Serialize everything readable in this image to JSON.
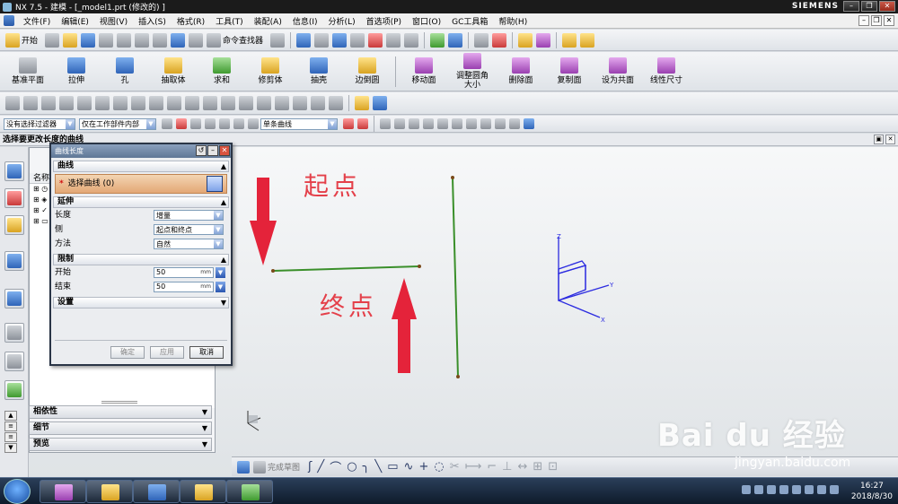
{
  "window": {
    "title": "NX 7.5 - 建模 - [_model1.prt (修改的) ]",
    "brand": "SIEMENS"
  },
  "menu": [
    "文件(F)",
    "编辑(E)",
    "视图(V)",
    "插入(S)",
    "格式(R)",
    "工具(T)",
    "装配(A)",
    "信息(I)",
    "分析(L)",
    "首选项(P)",
    "窗口(O)",
    "GC工具箱",
    "帮助(H)"
  ],
  "toolbar1": {
    "start": "开始",
    "command_finder": "命令查找器"
  },
  "feature_toolbar": {
    "left": [
      "基准平面",
      "拉伸",
      "孔",
      "抽取体",
      "求和",
      "修剪体",
      "抽壳",
      "边倒圆"
    ],
    "right": [
      "移动面",
      "调整圆角大小",
      "删除面",
      "复制面",
      "设为共面",
      "线性尺寸"
    ]
  },
  "filter_bar": {
    "type_filter": "没有选择过滤器",
    "scope": "仅在工作部件内部",
    "intent": "单条曲线"
  },
  "cue_line": "选择要更改长度的曲线",
  "navigator": {
    "column_name": "名称",
    "accordions": [
      "相依性",
      "细节",
      "预览"
    ]
  },
  "dialog": {
    "title": "曲线长度",
    "group_curve": "曲线",
    "select_curve": "选择曲线",
    "select_count": "(0)",
    "group_extend": "延伸",
    "length_label": "长度",
    "length_value": "增量",
    "side_label": "侧",
    "side_value": "起点和终点",
    "method_label": "方法",
    "method_value": "自然",
    "group_limits": "限制",
    "start_label": "开始",
    "start_value": "50",
    "end_label": "结束",
    "end_value": "50",
    "unit": "mm",
    "group_settings": "设置",
    "ok": "确定",
    "apply": "应用",
    "cancel": "取消"
  },
  "annotations": {
    "start_point": "起点",
    "end_point": "终点",
    "annotation_color": "#e4404a"
  },
  "wcs_axes": {
    "z": "Z",
    "y": "Y",
    "x": "X"
  },
  "sketch_toolbar": {
    "finish_sketch": "完成草图"
  },
  "watermark": {
    "brand": "Bai du 经验",
    "url": "jingyan.baidu.com"
  },
  "taskbar": {
    "time": "16:27",
    "date": "2018/8/30"
  }
}
